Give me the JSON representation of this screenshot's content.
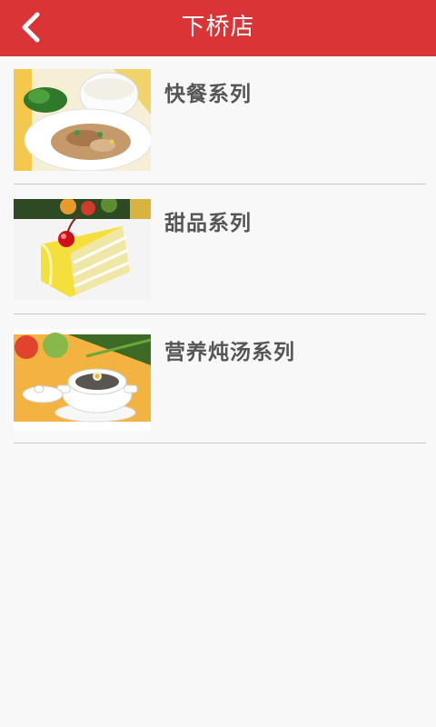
{
  "header": {
    "title": "下桥店",
    "back_icon": "chevron-left-icon",
    "background_color": "#db3437",
    "title_color": "#ffffff"
  },
  "categories": [
    {
      "label": "快餐系列",
      "image": "fast-food-plate-image"
    },
    {
      "label": "甜品系列",
      "image": "cake-slice-image"
    },
    {
      "label": "营养炖汤系列",
      "image": "stew-soup-pot-image"
    }
  ]
}
